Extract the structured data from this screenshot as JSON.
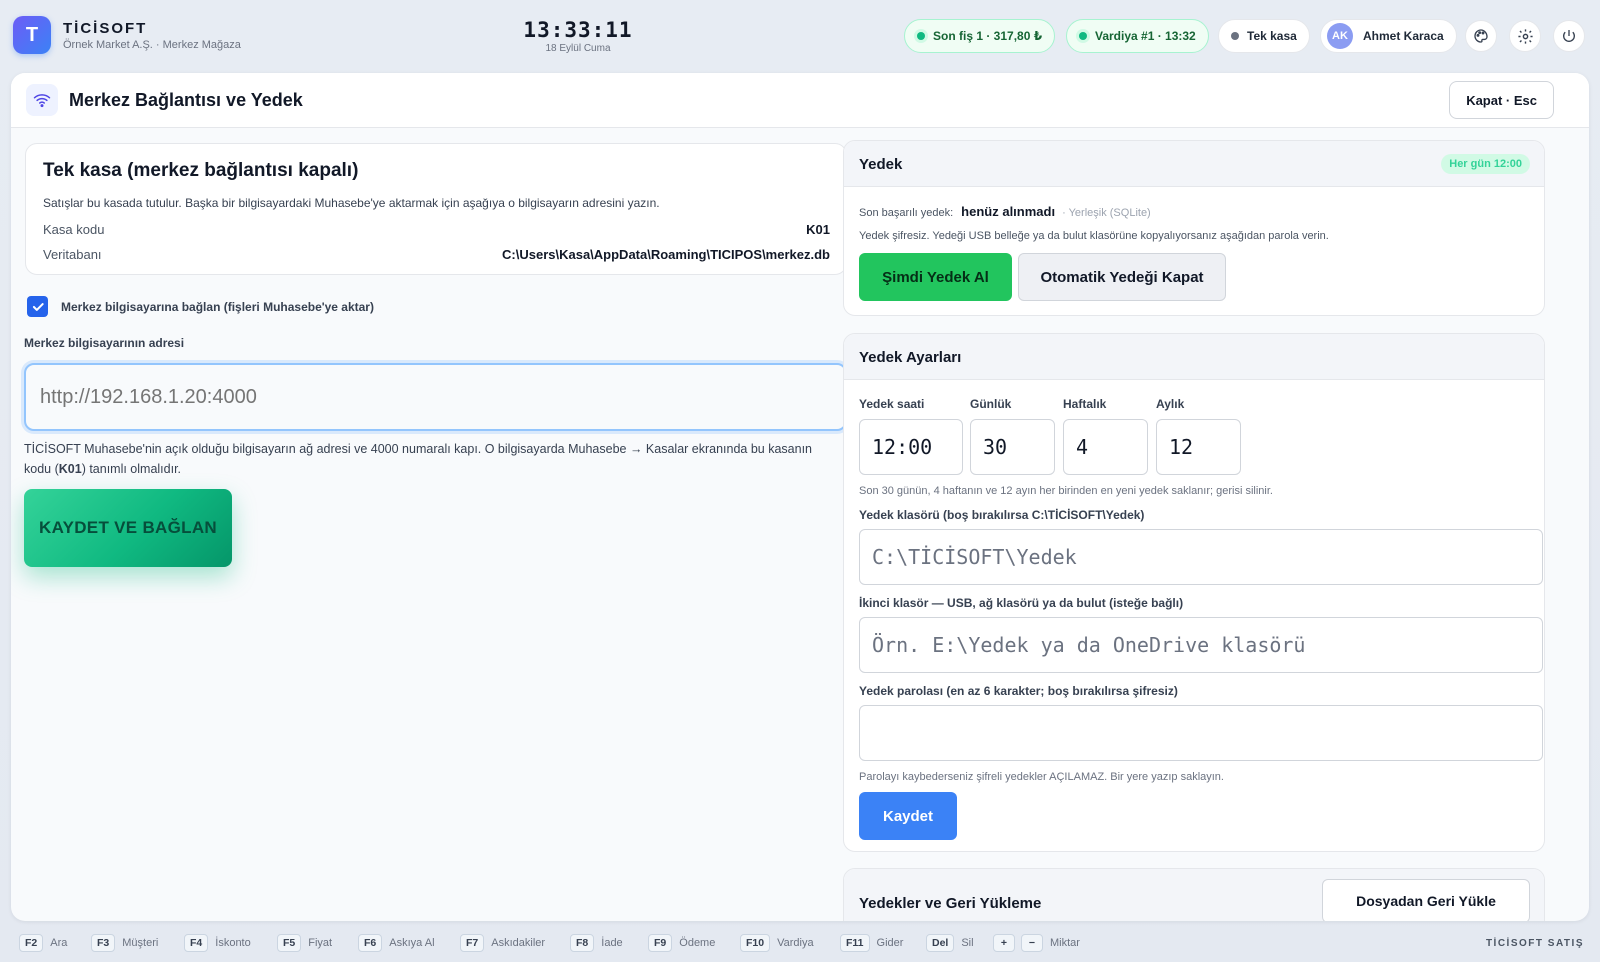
{
  "topbar": {
    "logo_letter": "T",
    "brand_name": "TİCİSOFT",
    "brand_sub": "Örnek Market A.Ş. · Merkez Mağaza",
    "clock_time": "13:33:11",
    "clock_date": "18 Eylül Cuma",
    "last_receipt": "Son fiş 1 · 317,80 ₺",
    "shift": "Vardiya #1 · 13:32",
    "register_mode": "Tek kasa",
    "user_initials": "AK",
    "user_name": "Ahmet Karaca"
  },
  "dialog": {
    "title": "Merkez Bağlantısı ve Yedek",
    "close_label": "Kapat · Esc"
  },
  "standalone": {
    "title": "Tek kasa (merkez bağlantısı kapalı)",
    "desc": "Satışlar bu kasada tutulur. Başka bir bilgisayardaki Muhasebe'ye aktarmak için aşağıya o bilgisayarın adresini yazın.",
    "register_code_label": "Kasa kodu",
    "register_code": "K01",
    "database_label": "Veritabanı",
    "database_path": "C:\\Users\\Kasa\\AppData\\Roaming\\TICIPOS\\merkez.db"
  },
  "connect": {
    "checkbox_label": "Merkez bilgisayarına bağlan (fişleri Muhasebe'ye aktar)",
    "checked": true,
    "address_label": "Merkez bilgisayarının adresi",
    "address_placeholder": "http://192.168.1.20:4000",
    "help_part1": "TİCİSOFT Muhasebe'nin açık olduğu bilgisayarın ağ adresi ve 4000 numaralı kapı. O bilgisayarda Muhasebe → Kasalar ekranında bu kasanın kodu (",
    "help_code": "K01",
    "help_part2": ") tanımlı olmalıdır.",
    "save_label": "KAYDET VE BAĞLAN"
  },
  "backup": {
    "title": "Yedek",
    "schedule_badge": "Her gün 12:00",
    "last_label": "Son başarılı yedek:",
    "last_value": "henüz alınmadı",
    "last_type": "· Yerleşik (SQLite)",
    "warning": "Yedek şifresiz. Yedeği USB belleğe ya da bulut klasörüne kopyalıyorsanız aşağıdan parola verin.",
    "backup_now_label": "Şimdi Yedek Al",
    "disable_auto_label": "Otomatik Yedeği Kapat"
  },
  "backup_settings": {
    "title": "Yedek Ayarları",
    "time_label": "Yedek saati",
    "time_value": "12:00",
    "daily_label": "Günlük",
    "daily_value": "30",
    "weekly_label": "Haftalık",
    "weekly_value": "4",
    "monthly_label": "Aylık",
    "monthly_value": "12",
    "retention_note": "Son 30 günün, 4 haftanın ve 12 ayın her birinden en yeni yedek saklanır; gerisi silinir.",
    "folder_label": "Yedek klasörü (boş bırakılırsa C:\\TİCİSOFT\\Yedek)",
    "folder_placeholder": "C:\\TİCİSOFT\\Yedek",
    "second_folder_label": "İkinci klasör — USB, ağ klasörü ya da bulut (isteğe bağlı)",
    "second_folder_placeholder": "Örn. E:\\Yedek ya da OneDrive klasörü",
    "password_label": "Yedek parolası (en az 6 karakter; boş bırakılırsa şifresiz)",
    "password_note": "Parolayı kaybederseniz şifreli yedekler AÇILAMAZ. Bir yere yazıp saklayın.",
    "save_label": "Kaydet"
  },
  "restore": {
    "title": "Yedekler ve Geri Yükleme",
    "button_label": "Dosyadan Geri Yükle"
  },
  "footer": {
    "shortcuts": [
      {
        "key": "F2",
        "label": "Ara"
      },
      {
        "key": "F3",
        "label": "Müşteri"
      },
      {
        "key": "F4",
        "label": "İskonto"
      },
      {
        "key": "F5",
        "label": "Fiyat"
      },
      {
        "key": "F6",
        "label": "Askıya Al"
      },
      {
        "key": "F7",
        "label": "Askıdakiler"
      },
      {
        "key": "F8",
        "label": "İade"
      },
      {
        "key": "F9",
        "label": "Ödeme"
      },
      {
        "key": "F10",
        "label": "Vardiya"
      },
      {
        "key": "F11",
        "label": "Gider"
      },
      {
        "key": "Del",
        "label": "Sil"
      }
    ],
    "plus_key": "+",
    "minus_key": "−",
    "qty_label": "Miktar",
    "brand": "TİCİSOFT SATIŞ"
  }
}
